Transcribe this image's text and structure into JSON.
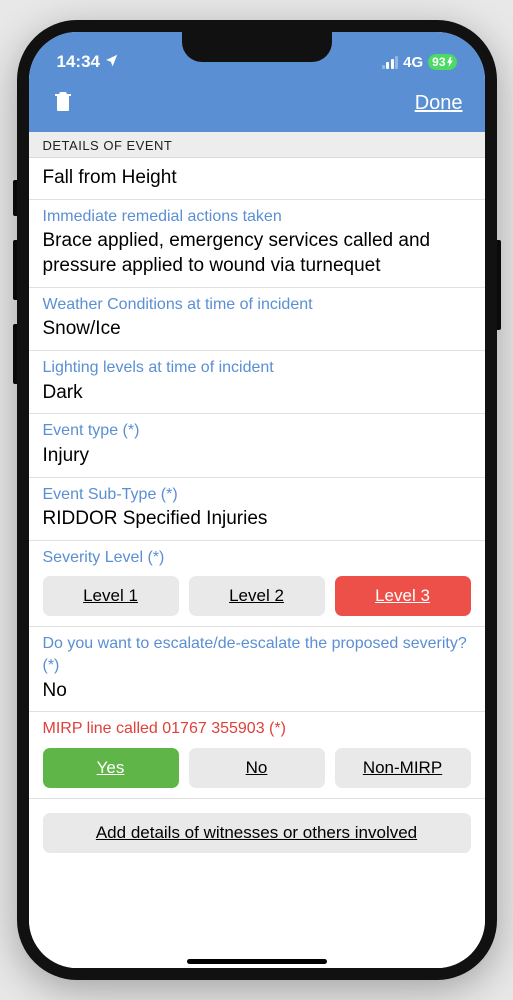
{
  "status": {
    "time": "14:34",
    "network": "4G",
    "battery": "93"
  },
  "header": {
    "done_label": "Done"
  },
  "section": {
    "title": "DETAILS OF EVENT"
  },
  "fields": {
    "event_details": {
      "value": "Fall from Height"
    },
    "remedial": {
      "label": "Immediate remedial actions taken",
      "value": "Brace applied, emergency services called and pressure applied to wound via turnequet"
    },
    "weather": {
      "label": "Weather Conditions at time of incident",
      "value": "Snow/Ice"
    },
    "lighting": {
      "label": "Lighting levels at time of incident",
      "value": "Dark"
    },
    "event_type": {
      "label": "Event type (*)",
      "value": "Injury"
    },
    "event_subtype": {
      "label": "Event Sub-Type (*)",
      "value": "RIDDOR Specified Injuries"
    },
    "severity": {
      "label": "Severity Level (*)",
      "options": {
        "level1": "Level 1",
        "level2": "Level 2",
        "level3": "Level 3"
      },
      "selected": "level3"
    },
    "escalate": {
      "label": "Do you want to escalate/de-escalate the proposed severity? (*)",
      "value": "No"
    },
    "mirp": {
      "label": "MIRP line called 01767 355903 (*)",
      "options": {
        "yes": "Yes",
        "no": "No",
        "nonmirp": "Non-MIRP"
      },
      "selected": "yes"
    }
  },
  "buttons": {
    "add_witness": "Add details of witnesses or others involved"
  }
}
